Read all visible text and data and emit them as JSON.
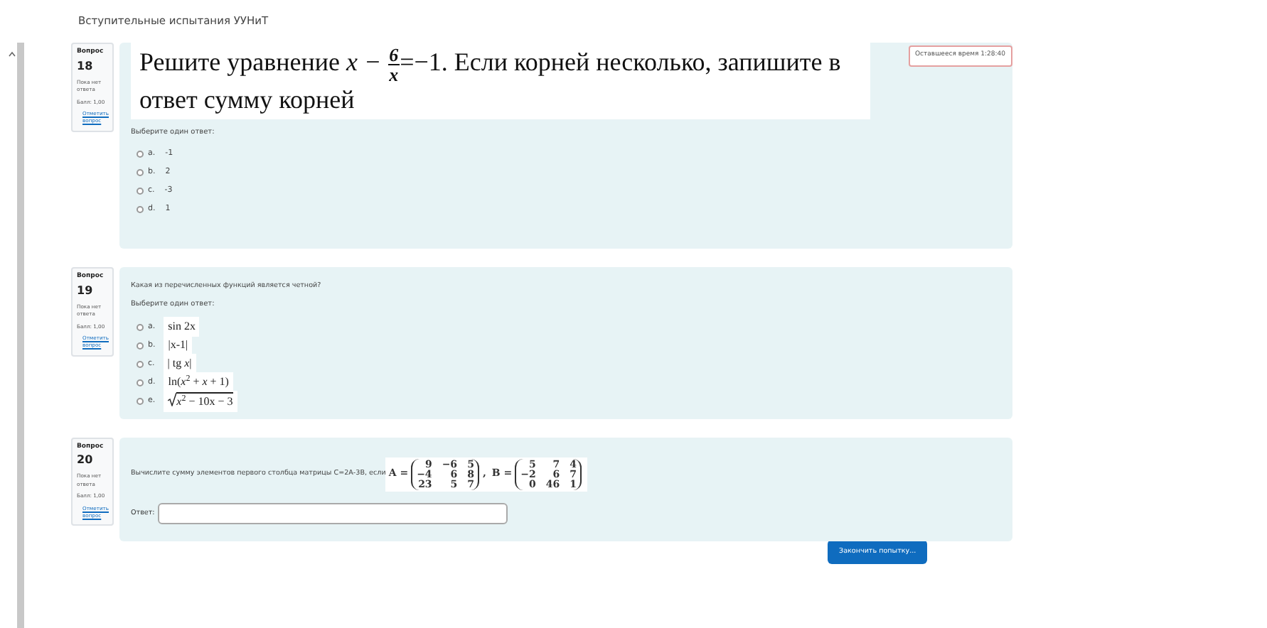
{
  "header": {
    "title": "Вступительные испытания УУНиТ"
  },
  "timer": {
    "label": "Оставшееся время 1:28:40"
  },
  "questions": [
    {
      "kind": "choice",
      "info": {
        "label": "Вопрос",
        "number": "18",
        "status": "Пока нет ответа",
        "score": "Балл: 1,00",
        "flag": "Отметить вопрос"
      },
      "text": {
        "prefix": "Решите уравнение",
        "math": {
          "lhs": "x −",
          "num": "6",
          "den": "x",
          "rhs": "=−1"
        },
        "suffix": ". Если корней несколько, запишите в ответ сумму корней"
      },
      "prompt": "Выберите один ответ:",
      "options": [
        {
          "letter": "a.",
          "kind": "plain",
          "text": "-1",
          "selected": false
        },
        {
          "letter": "b.",
          "kind": "plain",
          "text": "2",
          "selected": false
        },
        {
          "letter": "c.",
          "kind": "plain",
          "text": "-3",
          "selected": false
        },
        {
          "letter": "d.",
          "kind": "plain",
          "text": "1",
          "selected": false
        }
      ]
    },
    {
      "kind": "choice",
      "info": {
        "label": "Вопрос",
        "number": "19",
        "status": "Пока нет ответа",
        "score": "Балл: 1,00",
        "flag": "Отметить вопрос"
      },
      "plain_text": "Какая из перечисленных функций является четной?",
      "prompt": "Выберите один ответ:",
      "options": [
        {
          "letter": "a.",
          "kind": "math",
          "text": "sin 2x",
          "selected": false
        },
        {
          "letter": "b.",
          "kind": "math",
          "text": "|x-1|",
          "selected": false
        },
        {
          "letter": "c.",
          "kind": "math",
          "text": "| tg *x*|",
          "selected": false
        },
        {
          "letter": "d.",
          "kind": "math",
          "text": "ln(*x*$^{2}$ + *x* + 1)",
          "selected": false
        },
        {
          "letter": "e.",
          "kind": "sqrt",
          "text": "*x*$^{2}$ − 10x − 3",
          "selected": false
        }
      ]
    },
    {
      "kind": "input",
      "info": {
        "label": "Вопрос",
        "number": "20",
        "status": "Пока нет ответа",
        "score": "Балл: 1,00",
        "flag": "Отметить вопрос"
      },
      "plain_text": "Вычислите сумму элементов первого столбца матрицы С=2А-3В, если",
      "matrices": [
        {
          "label": "A =",
          "rows": [
            [
              "9",
              "−6",
              "5"
            ],
            [
              "−4",
              "6",
              "8"
            ],
            [
              "23",
              "5",
              "7"
            ]
          ],
          "after": ","
        },
        {
          "label": "B =",
          "rows": [
            [
              "5",
              "7",
              "4"
            ],
            [
              "−2",
              "6",
              "7"
            ],
            [
              "0",
              "46",
              "1"
            ]
          ]
        }
      ],
      "answer_label": "Ответ:"
    }
  ],
  "finish_button": "Закончить попытку..."
}
